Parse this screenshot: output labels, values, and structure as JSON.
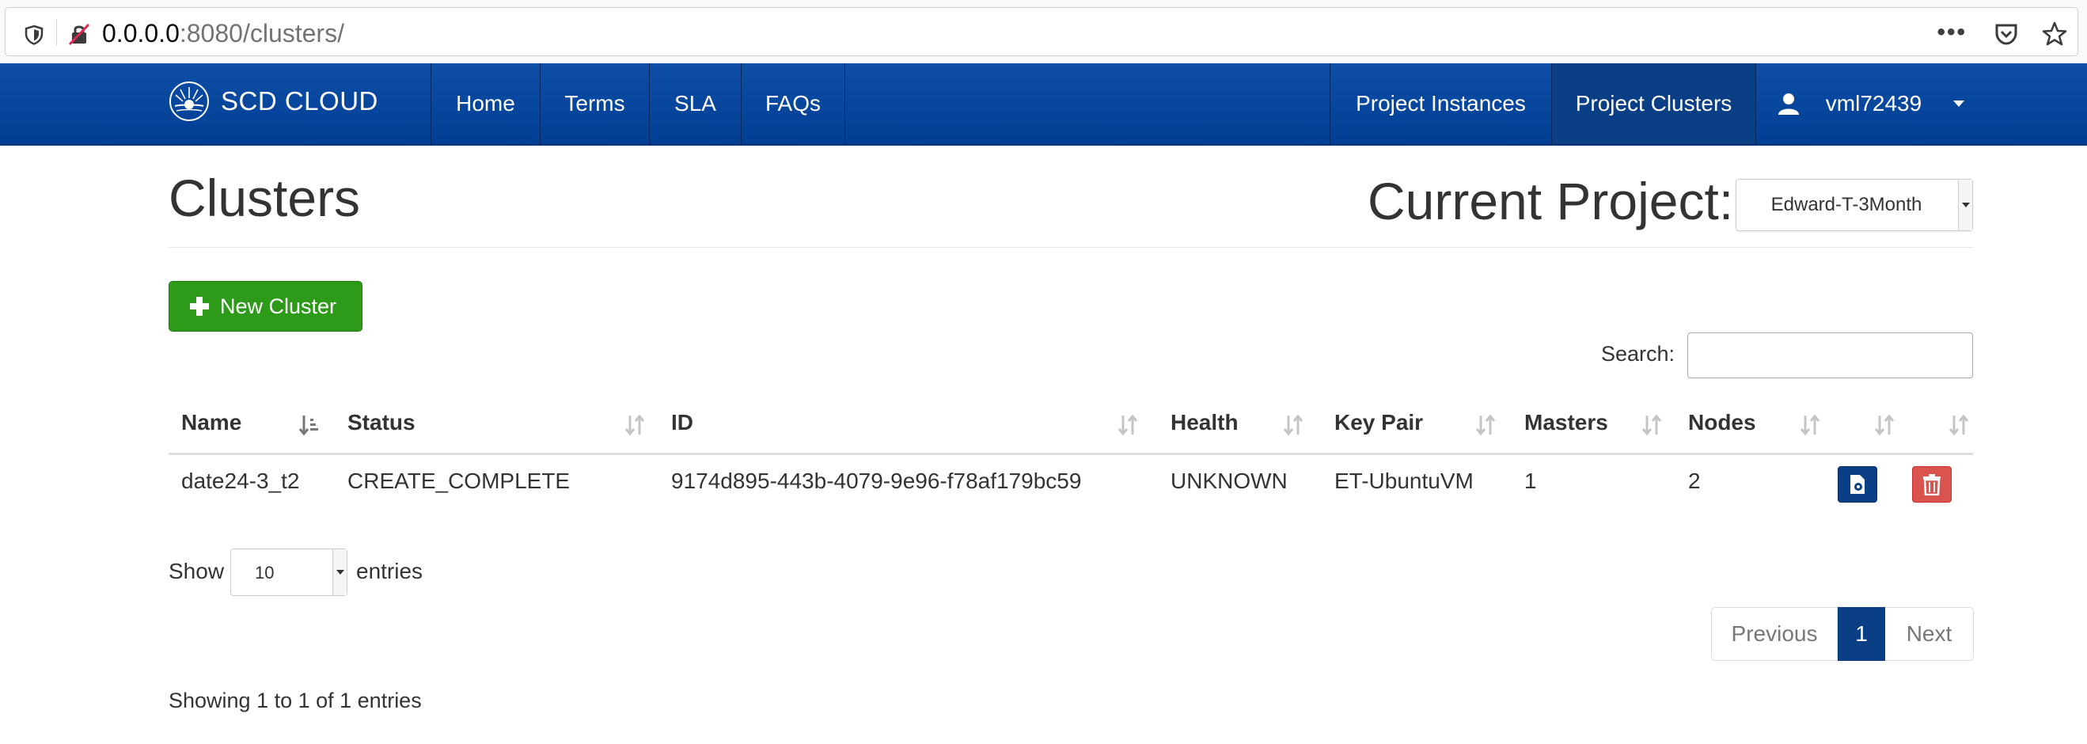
{
  "browser": {
    "url_host": "0.0.0.0",
    "url_rest": ":8080/clusters/",
    "more_label": "•••"
  },
  "navbar": {
    "brand": "SCD CLOUD",
    "items": [
      {
        "label": "Home"
      },
      {
        "label": "Terms"
      },
      {
        "label": "SLA"
      },
      {
        "label": "FAQs"
      }
    ],
    "right_items": [
      {
        "label": "Project Instances"
      },
      {
        "label": "Project Clusters",
        "active": true
      }
    ],
    "username": "vml72439"
  },
  "page": {
    "title": "Clusters",
    "project_label": "Current Project:",
    "project_value": "Edward-T-3Month"
  },
  "new_button_label": "New Cluster",
  "search": {
    "label": "Search:",
    "value": ""
  },
  "table": {
    "columns": [
      "Name",
      "Status",
      "ID",
      "Health",
      "Key Pair",
      "Masters",
      "Nodes",
      "",
      ""
    ],
    "rows": [
      {
        "name": "date24-3_t2",
        "status": "CREATE_COMPLETE",
        "id": "9174d895-443b-4079-9e96-f78af179bc59",
        "health": "UNKNOWN",
        "key_pair": "ET-UbuntuVM",
        "masters": "1",
        "nodes": "2"
      }
    ]
  },
  "length": {
    "show_label": "Show",
    "value": "10",
    "entries_label": "entries"
  },
  "pagination": {
    "previous": "Previous",
    "current": "1",
    "next": "Next"
  },
  "info": "Showing 1 to 1 of 1 entries",
  "colors": {
    "navbar": "#0e4ea7",
    "success": "#2e9a1a",
    "danger": "#d9534f",
    "primary": "#0a3f86"
  },
  "icons": [
    "shield-icon",
    "insecure-lock-icon",
    "pocket-icon",
    "bookmark-star-icon",
    "cloud-logo-icon",
    "user-icon",
    "plus-icon",
    "sort-icon",
    "edit-icon",
    "trash-icon"
  ]
}
